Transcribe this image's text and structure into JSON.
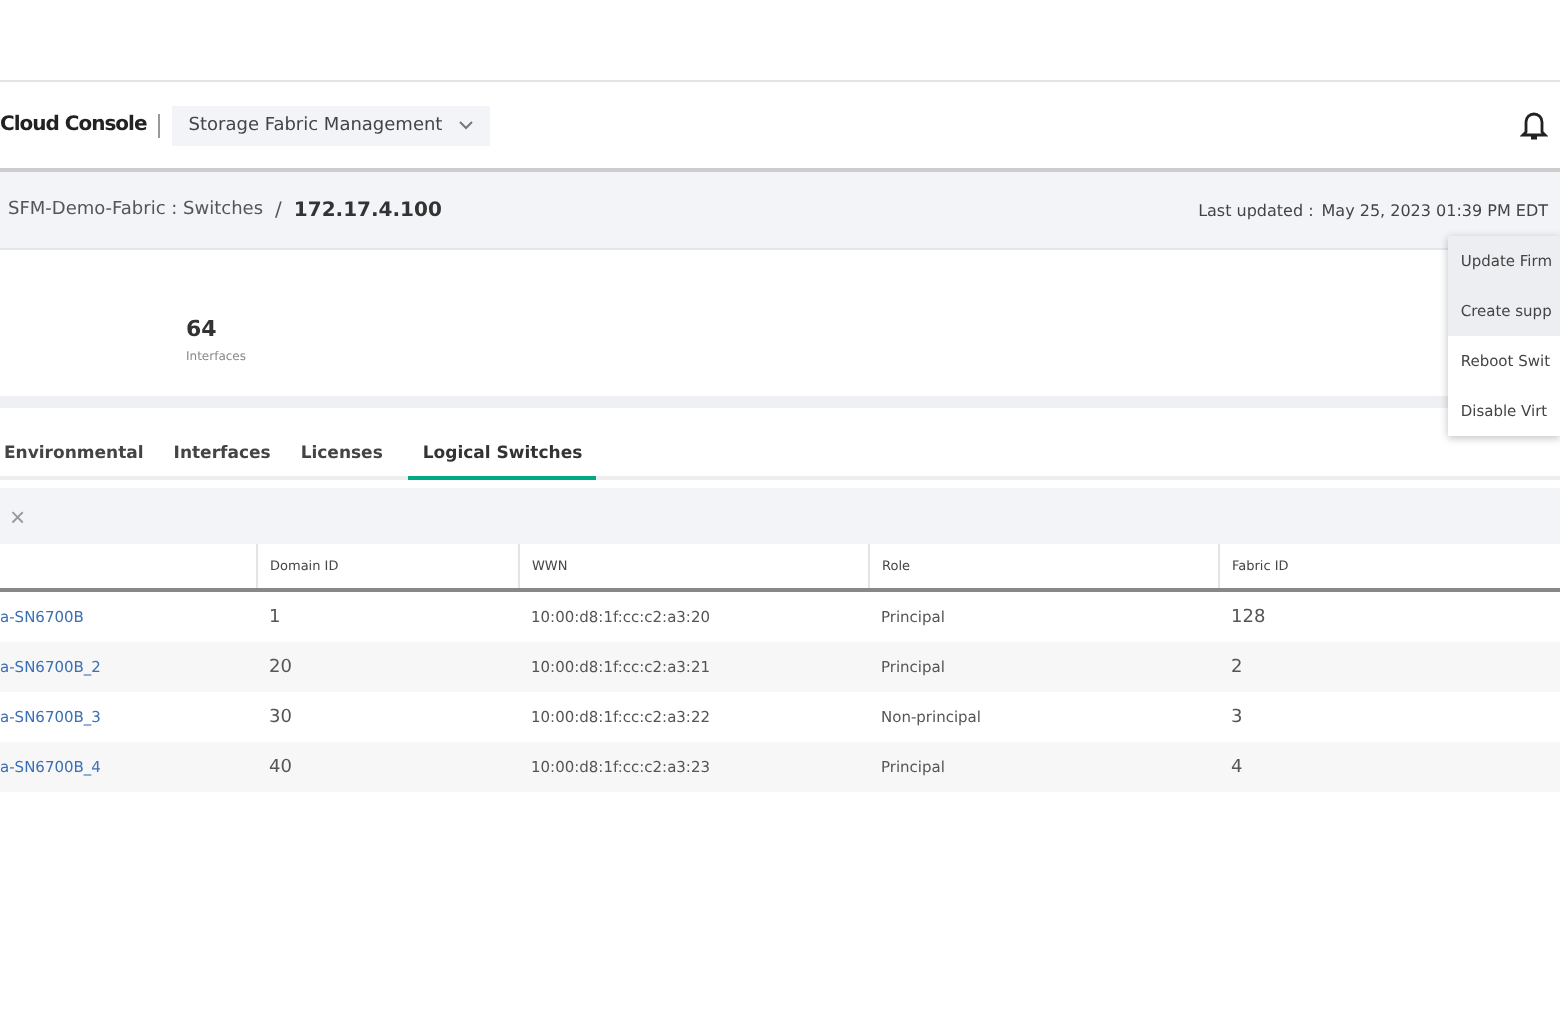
{
  "header": {
    "brand": "Cloud Console",
    "app_switcher": "Storage Fabric Management"
  },
  "breadcrumb": {
    "parent": "SFM-Demo-Fabric : Switches",
    "separator": "/",
    "current": "172.17.4.100",
    "last_updated_label": "Last updated :",
    "last_updated": "May 25, 2023 01:39 PM EDT"
  },
  "stats": [
    {
      "value": "64",
      "label": "Interfaces"
    }
  ],
  "actions_menu": [
    {
      "label": "Update Firm",
      "highlighted": true
    },
    {
      "label": "Create supp",
      "highlighted": true
    },
    {
      "label": "Reboot Swit",
      "highlighted": false
    },
    {
      "label": "Disable Virt",
      "highlighted": false
    }
  ],
  "tabs": [
    {
      "label": "Environmental",
      "selected": false
    },
    {
      "label": "Interfaces",
      "selected": false
    },
    {
      "label": "Licenses",
      "selected": false
    },
    {
      "label": "Logical Switches",
      "selected": true
    }
  ],
  "toolbar": {
    "clear": "×"
  },
  "table": {
    "columns": [
      "",
      "Domain ID",
      "WWN",
      "Role",
      "Fabric ID"
    ],
    "rows": [
      [
        "a-SN6700B",
        "1",
        "10:00:d8:1f:cc:c2:a3:20",
        "Principal",
        "128"
      ],
      [
        "a-SN6700B_2",
        "20",
        "10:00:d8:1f:cc:c2:a3:21",
        "Principal",
        "2"
      ],
      [
        "a-SN6700B_3",
        "30",
        "10:00:d8:1f:cc:c2:a3:22",
        "Non-principal",
        "3"
      ],
      [
        "a-SN6700B_4",
        "40",
        "10:00:d8:1f:cc:c2:a3:23",
        "Principal",
        "4"
      ]
    ]
  }
}
